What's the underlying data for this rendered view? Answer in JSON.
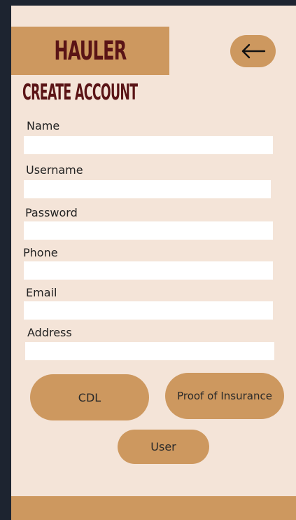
{
  "app": {
    "title": "HAULER",
    "back_icon": "arrow-left-icon"
  },
  "page": {
    "heading": "CREATE ACCOUNT"
  },
  "form": {
    "fields": [
      {
        "label": "Name",
        "value": "",
        "placeholder": ""
      },
      {
        "label": "Username",
        "value": "",
        "placeholder": ""
      },
      {
        "label": "Password",
        "value": "",
        "placeholder": ""
      },
      {
        "label": "Phone",
        "value": "",
        "placeholder": ""
      },
      {
        "label": "Email",
        "value": "",
        "placeholder": ""
      },
      {
        "label": "Address",
        "value": "",
        "placeholder": ""
      }
    ]
  },
  "buttons": {
    "cdl": "CDL",
    "insurance": "Proof of Insurance",
    "user": "User"
  },
  "colors": {
    "background": "#f4e4d8",
    "accent": "#cd985f",
    "title": "#5a1416",
    "input": "#ffffff"
  }
}
